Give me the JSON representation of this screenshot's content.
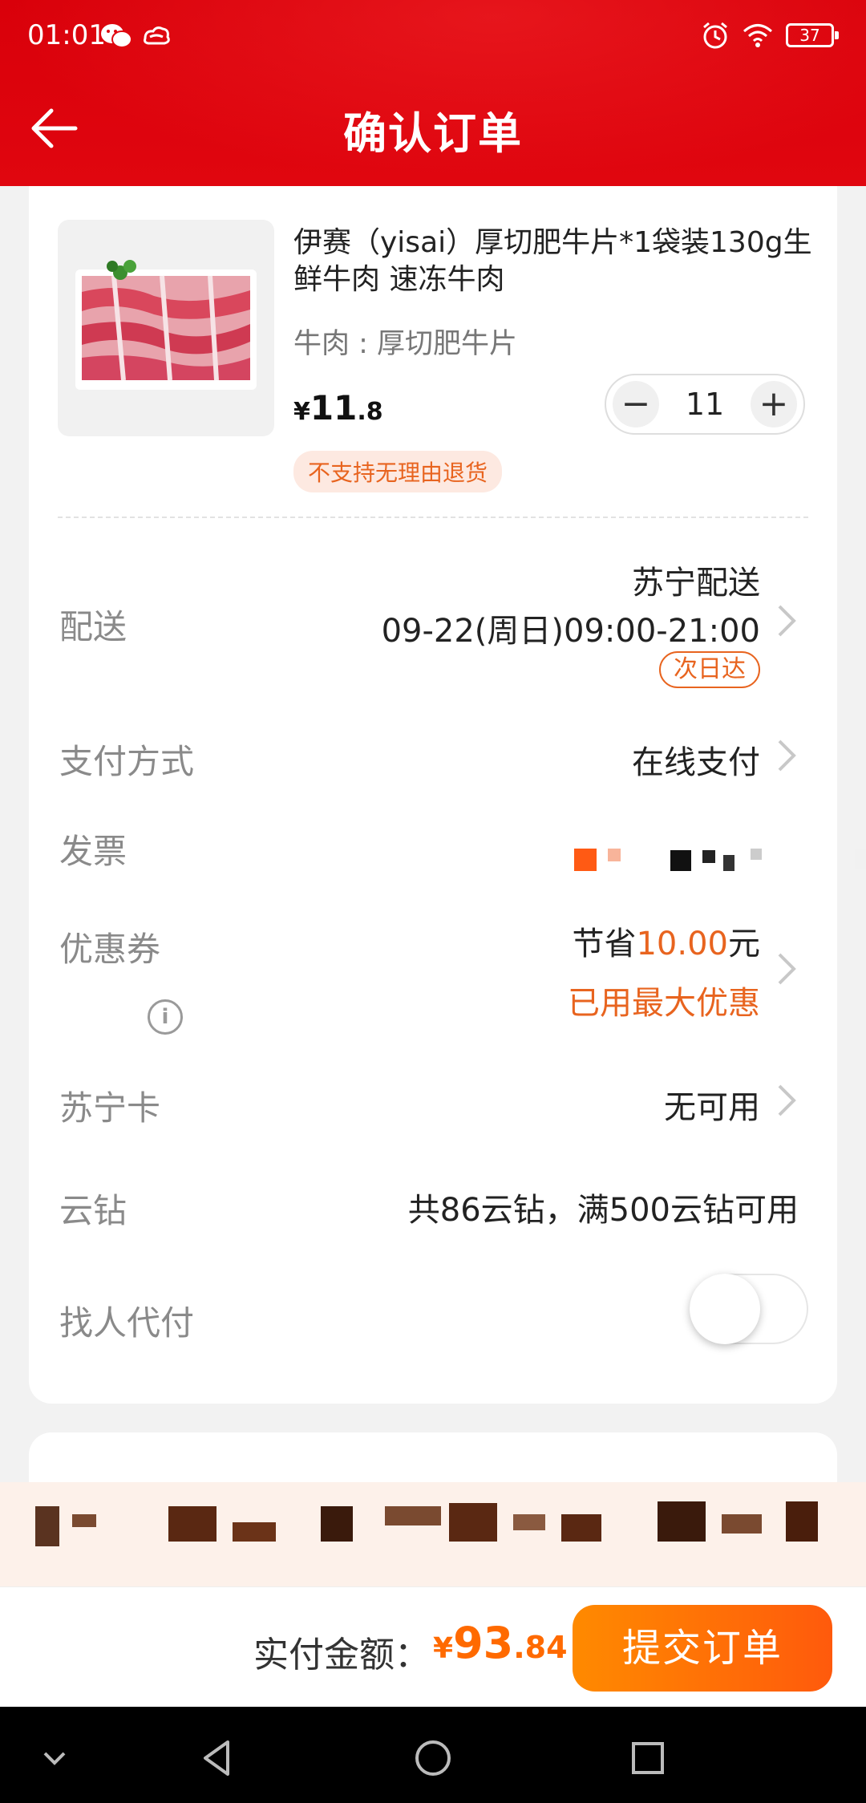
{
  "status_bar": {
    "time": "01:01",
    "battery": "37",
    "icons_left": [
      "wechat-icon",
      "cloud-icon"
    ],
    "icons_right": [
      "alarm-icon",
      "wifi-icon",
      "battery-icon"
    ]
  },
  "header": {
    "title": "确认订单",
    "back_icon": "arrow-left-icon"
  },
  "product": {
    "title": "伊赛（yisai）厚切肥牛片*1袋装130g生鲜牛肉 速冻牛肉",
    "spec": "牛肉 : 厚切肥牛片",
    "price_currency": "¥",
    "price_int": "11",
    "price_dec": ".8",
    "quantity": "11",
    "minus": "−",
    "plus": "+",
    "tag": "不支持无理由退货"
  },
  "rows": {
    "delivery": {
      "label": "配送",
      "provider": "苏宁配送",
      "time": "09-22(周日)09:00-21:00",
      "tag": "次日达"
    },
    "payment": {
      "label": "支付方式",
      "value": "在线支付"
    },
    "invoice": {
      "label": "发票"
    },
    "coupon": {
      "label": "优惠券",
      "save_prefix": "节省",
      "save_amount": "10.00",
      "save_suffix": "元",
      "note": "已用最大优惠"
    },
    "suning_card": {
      "label": "苏宁卡",
      "value": "无可用"
    },
    "cloud_diamond": {
      "label": "云钻",
      "info": "i",
      "value": "共86云钻，满500云钻可用"
    },
    "pay_for_me": {
      "label": "找人代付",
      "enabled": false
    }
  },
  "checkout": {
    "label": "实付金额：",
    "currency": "¥",
    "amount_int": "93",
    "amount_dec": ".84",
    "submit": "提交订单"
  },
  "colors": {
    "header_red": "#e0060f",
    "accent_orange": "#e8641f",
    "submit_orange": "#ff6a00"
  }
}
